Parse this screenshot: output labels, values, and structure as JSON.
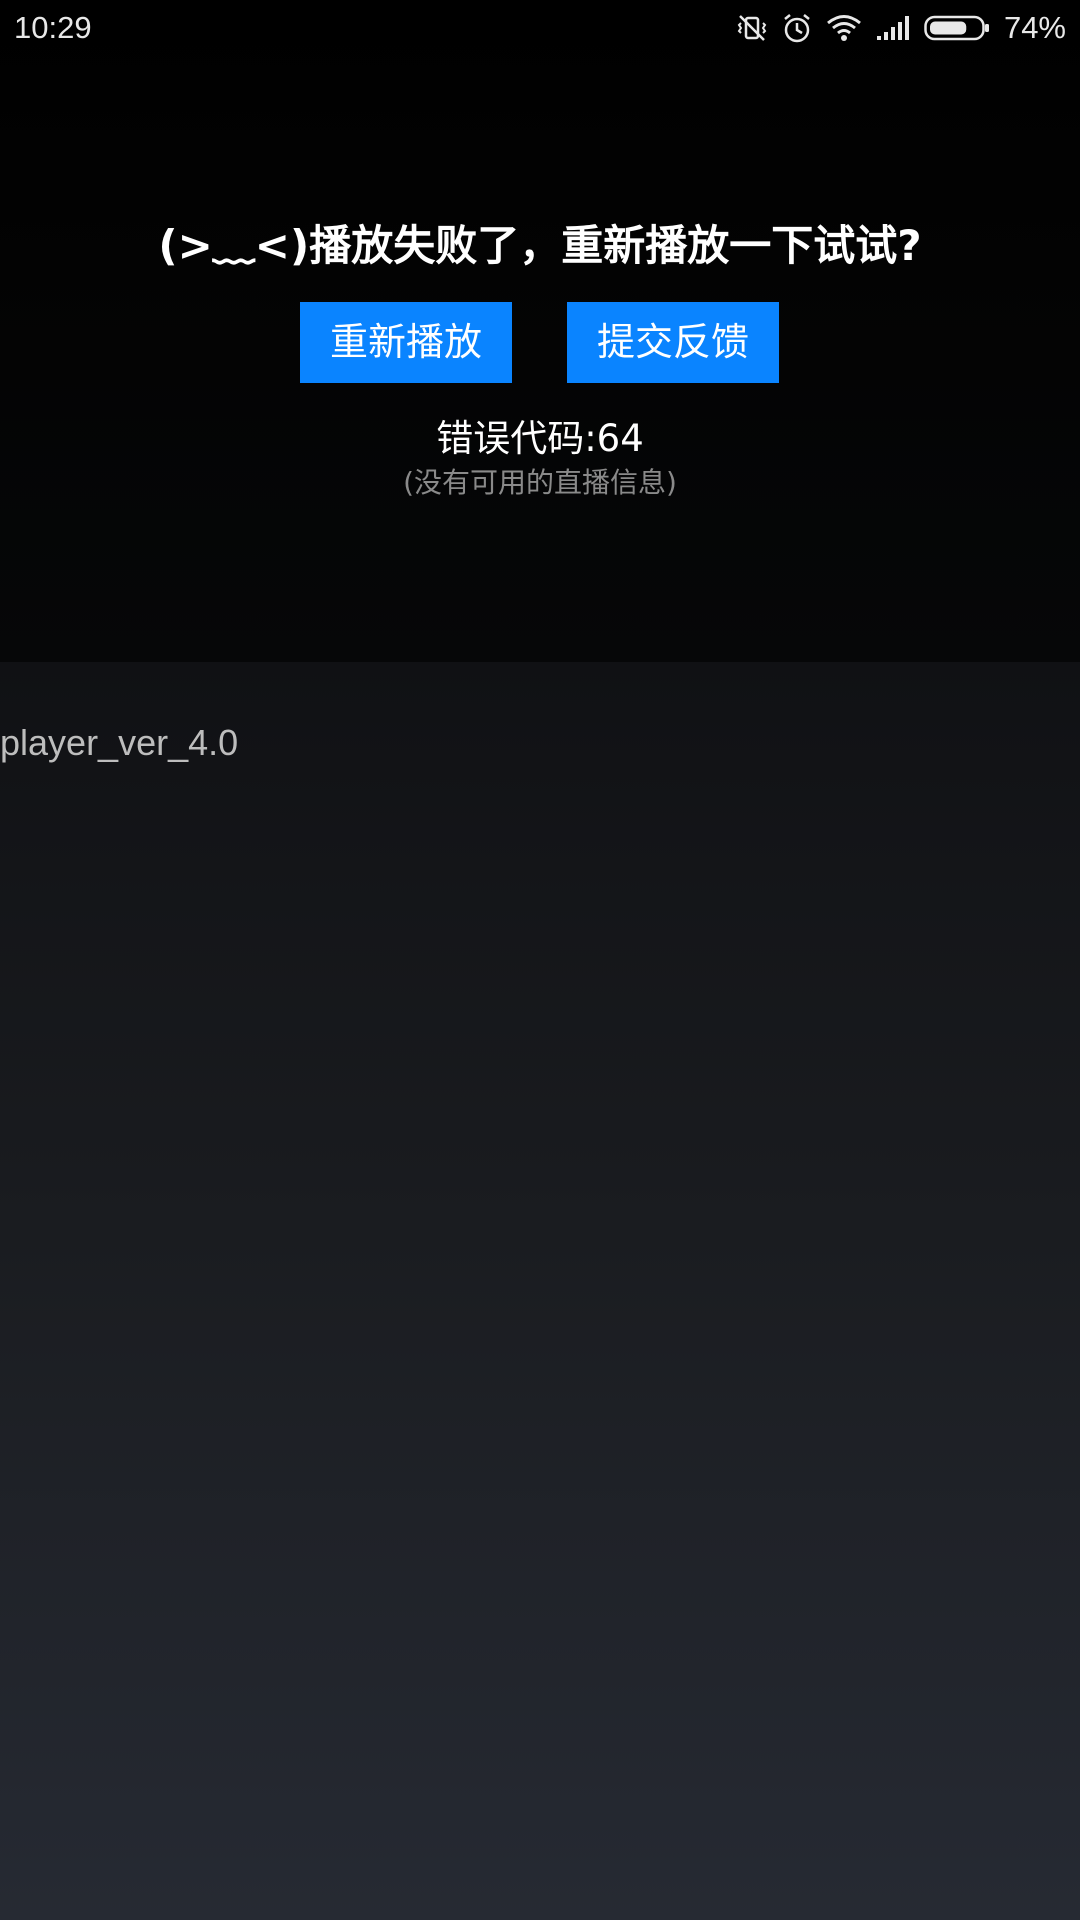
{
  "status_bar": {
    "time": "10:29",
    "battery_percent": "74%",
    "battery_level": 0.74,
    "icons": [
      "vibrate-off-icon",
      "alarm-icon",
      "wifi-icon",
      "signal-icon",
      "battery-icon"
    ]
  },
  "error": {
    "title": "(>﹏<)播放失败了，重新播放一下试试?",
    "replay_label": "重新播放",
    "feedback_label": "提交反馈",
    "code_text": "错误代码:64",
    "message": "(没有可用的直播信息)"
  },
  "player_version": "player_ver_4.0",
  "colors": {
    "button_bg": "#0a84ff",
    "title_text": "#ffffff",
    "secondary_text": "#8a8a8a",
    "version_text": "#bdbdbd"
  }
}
